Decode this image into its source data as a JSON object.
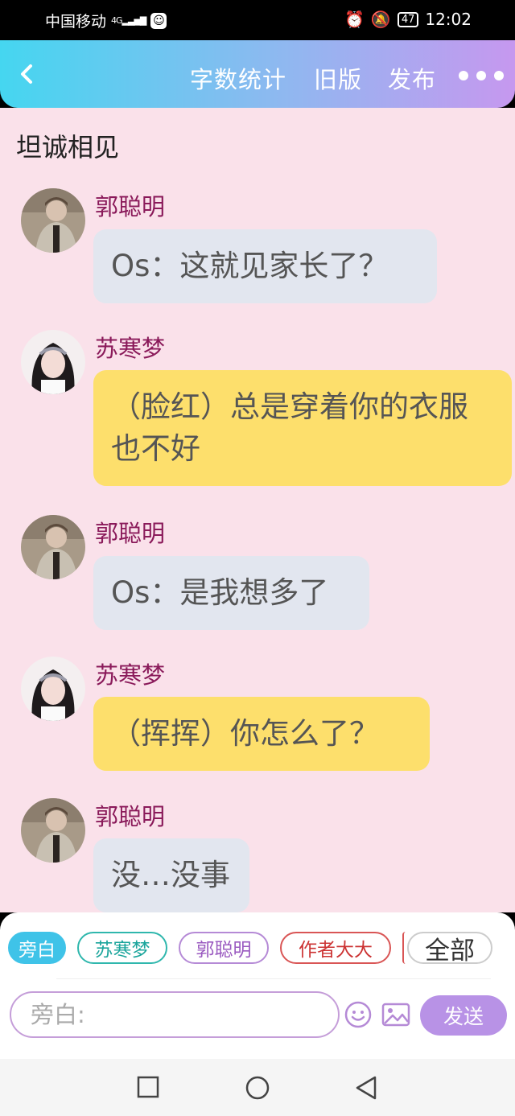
{
  "status": {
    "carrier": "中国移动",
    "net": "4G",
    "battery": "47",
    "time": "12:02"
  },
  "appbar": {
    "word_count": "字数统计",
    "old_version": "旧版",
    "publish": "发布"
  },
  "chat": {
    "title": "坦诚相见",
    "messages": [
      {
        "name": "郭聪明",
        "text": "Os：这就见家长了？"
      },
      {
        "name": "苏寒梦",
        "text": "（脸红）总是穿着你的衣服也不好"
      },
      {
        "name": "郭聪明",
        "text": "Os：是我想多了"
      },
      {
        "name": "苏寒梦",
        "text": "（挥挥）你怎么了？"
      },
      {
        "name": "郭聪明",
        "text": "没…没事"
      }
    ]
  },
  "composer": {
    "chips": [
      "旁白",
      "苏寒梦",
      "郭聪明",
      "作者大大"
    ],
    "all_label": "全部",
    "input_placeholder": "旁白:",
    "send_label": "发送"
  }
}
